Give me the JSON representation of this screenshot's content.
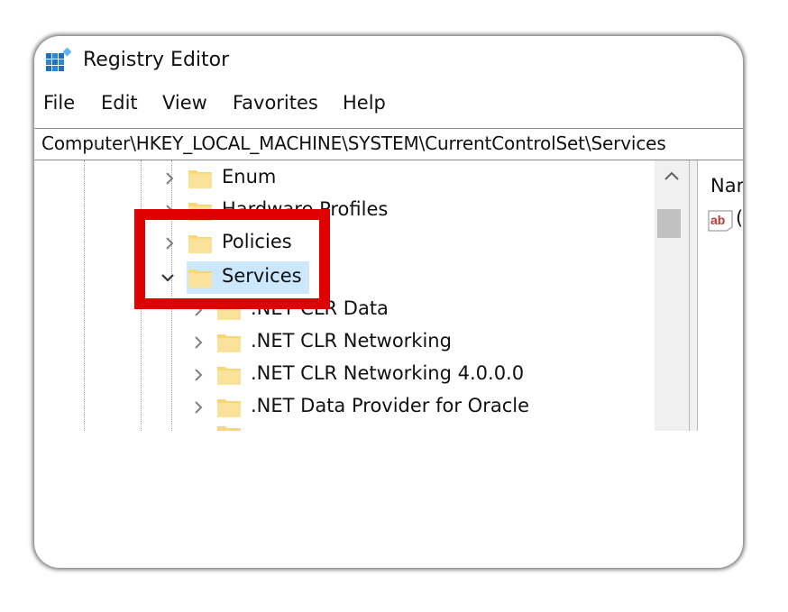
{
  "window": {
    "title": "Registry Editor",
    "app_icon": "registry-editor-icon"
  },
  "menu": {
    "items": [
      "File",
      "Edit",
      "View",
      "Favorites",
      "Help"
    ]
  },
  "address": {
    "path": "Computer\\HKEY_LOCAL_MACHINE\\SYSTEM\\CurrentControlSet\\Services"
  },
  "tree": {
    "nodes": [
      {
        "label": "Enum",
        "state": "collapsed",
        "level": 1
      },
      {
        "label": "Hardware Profiles",
        "state": "collapsed",
        "level": 1
      },
      {
        "label": "Policies",
        "state": "collapsed",
        "level": 1,
        "partially_hidden": true
      },
      {
        "label": "Services",
        "state": "expanded",
        "level": 1,
        "selected": true,
        "highlighted": true
      },
      {
        "label": ".NET CLR Data",
        "state": "collapsed",
        "level": 2
      },
      {
        "label": ".NET CLR Networking",
        "state": "collapsed",
        "level": 2
      },
      {
        "label": ".NET CLR Networking 4.0.0.0",
        "state": "collapsed",
        "level": 2
      },
      {
        "label": ".NET Data Provider for Oracle",
        "state": "collapsed",
        "level": 2
      }
    ]
  },
  "values_pane": {
    "column_header": "Nar",
    "first_value_icon": "string-value-icon",
    "first_value_partial": "("
  },
  "colors": {
    "highlight": "#e00000",
    "selection": "#cce8ff",
    "folder": "#f8d775"
  }
}
